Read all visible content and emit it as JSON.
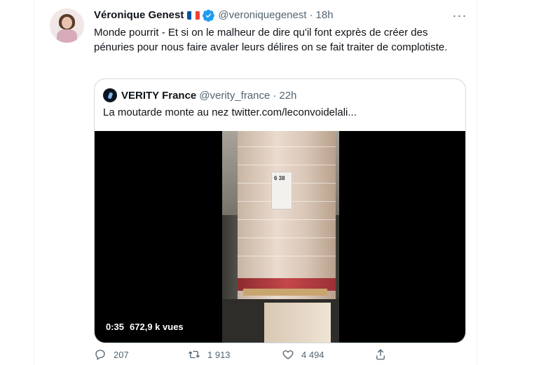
{
  "tweet": {
    "author_name": "Véronique Genest",
    "author_handle": "@veroniquegenest",
    "separator": "·",
    "time": "18h",
    "text": "Monde pourrit - Et si on le malheur de dire qu'il font exprès de créer des pénuries pour nous faire avaler leurs délires on se fait traiter de complotiste.",
    "more_icon": "ellipsis-icon",
    "flag_colors": [
      "#0055a4",
      "#ffffff",
      "#ef4135"
    ]
  },
  "quote": {
    "author_name": "VERITY France",
    "author_handle": "@verity_france",
    "separator": "·",
    "time": "22h",
    "text": "La moutarde monte au nez  twitter.com/leconvoidelali...",
    "video": {
      "duration": "0:35",
      "views": "672,9 k vues",
      "label_text": "6 38"
    }
  },
  "actions": {
    "replies": "207",
    "retweets": "1 913",
    "likes": "4 494"
  },
  "colors": {
    "text": "#0f1419",
    "secondary": "#536471",
    "border": "#cfd9de",
    "verified": "#1d9bf0"
  }
}
